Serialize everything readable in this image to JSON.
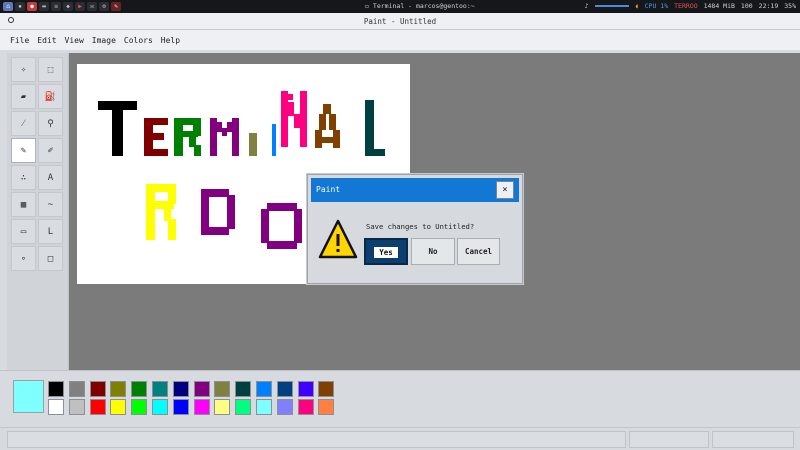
{
  "system_bar": {
    "window_title": "Terminal - marcos@gentoo:~",
    "cpu": "CPU 1%",
    "terror_label": "TERROO",
    "memory": "1484 MiB",
    "brightness": "100",
    "clock": "22:19",
    "battery": "35%"
  },
  "window": {
    "title": "Paint - Untitled"
  },
  "menu": [
    "File",
    "Edit",
    "View",
    "Image",
    "Colors",
    "Help"
  ],
  "tools": [
    {
      "name": "free-select-icon",
      "glyph": "✧"
    },
    {
      "name": "rect-select-icon",
      "glyph": "⬚"
    },
    {
      "name": "eraser-icon",
      "glyph": "▰"
    },
    {
      "name": "fill-bucket-icon",
      "glyph": "⛽"
    },
    {
      "name": "color-picker-icon",
      "glyph": "⁄"
    },
    {
      "name": "magnifier-icon",
      "glyph": "⚲"
    },
    {
      "name": "pencil-icon",
      "glyph": "✎"
    },
    {
      "name": "brush-icon",
      "glyph": "✐"
    },
    {
      "name": "airbrush-icon",
      "glyph": "∴"
    },
    {
      "name": "text-icon",
      "glyph": "A"
    },
    {
      "name": "shape-fill-icon",
      "glyph": "▦"
    },
    {
      "name": "curve-icon",
      "glyph": "~"
    },
    {
      "name": "rectangle-icon",
      "glyph": "▭"
    },
    {
      "name": "line-icon",
      "glyph": "L"
    },
    {
      "name": "ellipse-icon",
      "glyph": "∘"
    },
    {
      "name": "rounded-rect-icon",
      "glyph": "□"
    }
  ],
  "colors": {
    "current": "#80ffff",
    "row1": [
      "#000000",
      "#808080",
      "#800000",
      "#808000",
      "#008000",
      "#008080",
      "#000080",
      "#800080",
      "#808040",
      "#004040",
      "#0080ff",
      "#004080",
      "#4000ff",
      "#804000"
    ],
    "row2": [
      "#ffffff",
      "#c0c0c0",
      "#ff0000",
      "#ffff00",
      "#00ff00",
      "#00ffff",
      "#0000ff",
      "#ff00ff",
      "#ffff80",
      "#00ff80",
      "#80ffff",
      "#8080ff",
      "#ff0080",
      "#ff8040"
    ]
  },
  "dialog": {
    "title": "Paint",
    "close": "×",
    "message": "Save changes to Untitled?",
    "yes": "Yes",
    "no": "No",
    "cancel": "Cancel"
  }
}
